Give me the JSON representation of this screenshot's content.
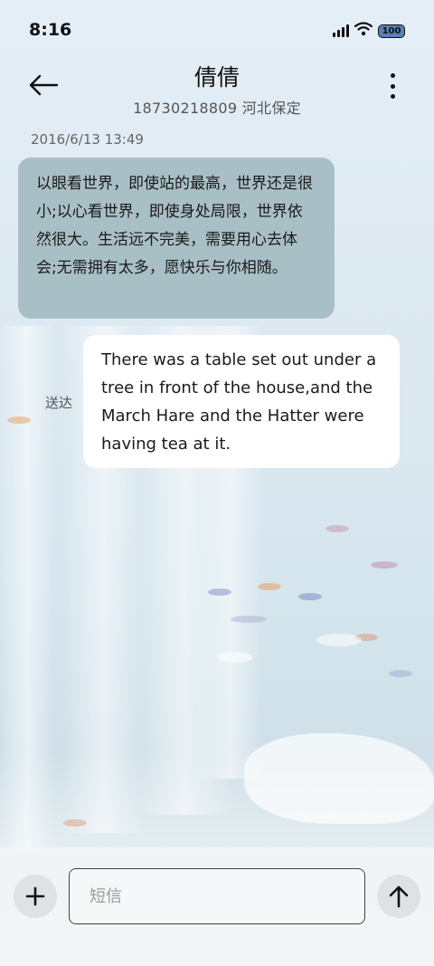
{
  "status_bar": {
    "time": "8:16",
    "battery": "100"
  },
  "header": {
    "name": "倩倩",
    "subtitle": "18730218809 河北保定"
  },
  "conversation": {
    "timestamp": "2016/6/13 13:49",
    "incoming_message": "以眼看世界，即使站的最高，世界还是很小;以心看世界，即使身处局限，世界依然很大。生活远不完美，需要用心去体会;无需拥有太多，愿快乐与你相随。",
    "outgoing_status": "送达",
    "outgoing_message": "There was a table set out under a tree in front of the house,and the March Hare and the Hatter were having tea at it."
  },
  "composer": {
    "placeholder": "短信"
  },
  "icons": {
    "back": "arrow-left-icon",
    "more": "more-vertical-icon",
    "add": "plus-icon",
    "send": "arrow-up-icon",
    "signal": "signal-icon",
    "wifi": "wifi-icon",
    "battery": "battery-icon"
  }
}
